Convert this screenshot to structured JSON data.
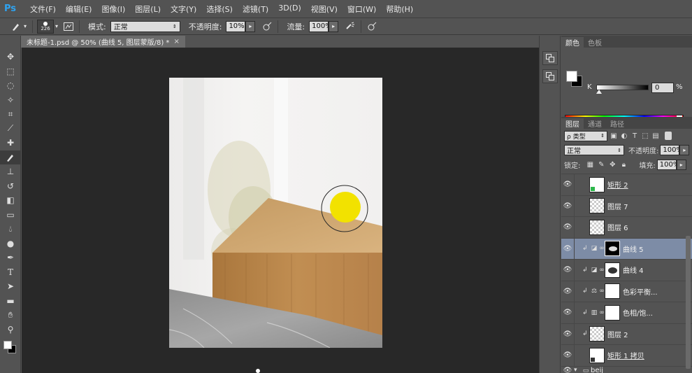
{
  "menubar": {
    "logo": "Ps",
    "items": [
      "文件(F)",
      "编辑(E)",
      "图像(I)",
      "图层(L)",
      "文字(Y)",
      "选择(S)",
      "滤镜(T)",
      "3D(D)",
      "视图(V)",
      "窗口(W)",
      "帮助(H)"
    ]
  },
  "options": {
    "brush_size": "226",
    "mode_label": "模式:",
    "mode_value": "正常",
    "opacity_label": "不透明度:",
    "opacity_value": "10%",
    "flow_label": "流量:",
    "flow_value": "100%"
  },
  "tab": {
    "title": "未标题-1.psd @ 50% (曲线 5, 图层蒙版/8) *",
    "close": "×"
  },
  "color_panel": {
    "tabs": [
      "颜色",
      "色板"
    ],
    "channel_label": "K",
    "channel_value": "0",
    "unit": "%"
  },
  "layers_panel": {
    "tabs": [
      "图层",
      "通道",
      "路径"
    ],
    "filter_label": "ρ 类型",
    "blend_mode": "正常",
    "opacity_label": "不透明度:",
    "opacity_value": "100%",
    "lock_label": "锁定:",
    "fill_label": "填充:",
    "fill_value": "100%",
    "layers": [
      {
        "name": "矩形 2",
        "thumb": "white",
        "selected": false
      },
      {
        "name": "图层 7",
        "thumb": "checker",
        "selected": false
      },
      {
        "name": "图层 6",
        "thumb": "checker",
        "selected": false
      },
      {
        "name": "曲线 5",
        "thumb": "black",
        "selected": true
      },
      {
        "name": "曲线 4",
        "thumb": "white",
        "selected": false
      },
      {
        "name": "色彩平衡...",
        "thumb": "white",
        "selected": false
      },
      {
        "name": "色相/饱...",
        "thumb": "white",
        "selected": false
      },
      {
        "name": "图层 2",
        "thumb": "checker",
        "selected": false
      },
      {
        "name": "矩形 1 拷贝",
        "thumb": "white",
        "selected": false
      },
      {
        "name": "beij",
        "thumb": "",
        "selected": false
      }
    ]
  }
}
